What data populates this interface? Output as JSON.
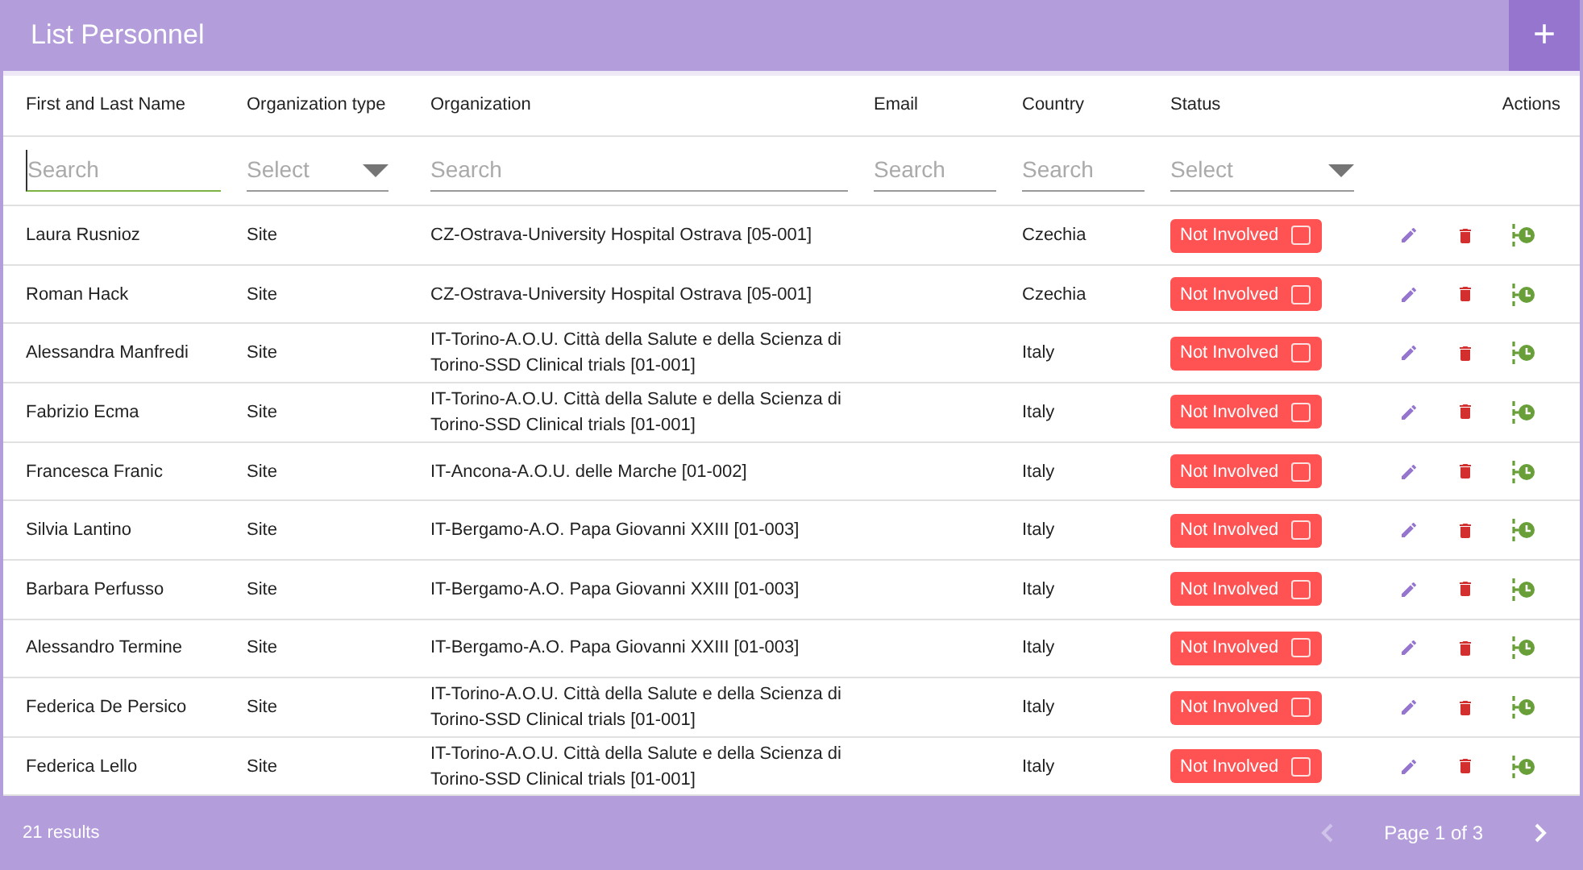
{
  "header": {
    "title": "List Personnel",
    "add_button": "+"
  },
  "columns": [
    "First and Last Name",
    "Organization type",
    "Organization",
    "Email",
    "Country",
    "Status",
    "Actions"
  ],
  "filters": [
    {
      "kind": "text",
      "placeholder": "Search",
      "focused": true
    },
    {
      "kind": "select",
      "placeholder": "Select",
      "focused": false
    },
    {
      "kind": "text",
      "placeholder": "Search",
      "focused": false
    },
    {
      "kind": "text",
      "placeholder": "Search",
      "focused": false
    },
    {
      "kind": "text",
      "placeholder": "Search",
      "focused": false
    },
    {
      "kind": "select",
      "placeholder": "Select",
      "focused": false
    }
  ],
  "rows": [
    {
      "name": "Laura Rusnioz",
      "type": "Site",
      "organization": "CZ-Ostrava-University Hospital Ostrava [05-001]",
      "email": "",
      "country": "Czechia",
      "status": "Not Involved",
      "checked": false
    },
    {
      "name": "Roman Hack",
      "type": "Site",
      "organization": "CZ-Ostrava-University Hospital Ostrava [05-001]",
      "email": "",
      "country": "Czechia",
      "status": "Not Involved",
      "checked": false
    },
    {
      "name": "Alessandra Manfredi",
      "type": "Site",
      "organization": "IT-Torino-A.O.U. Città della Salute e della Scienza di Torino-SSD Clinical trials [01-001]",
      "email": "",
      "country": "Italy",
      "status": "Not Involved",
      "checked": false
    },
    {
      "name": "Fabrizio Ecma",
      "type": "Site",
      "organization": "IT-Torino-A.O.U. Città della Salute e della Scienza di Torino-SSD Clinical trials [01-001]",
      "email": "",
      "country": "Italy",
      "status": "Not Involved",
      "checked": false
    },
    {
      "name": "Francesca Franic",
      "type": "Site",
      "organization": "IT-Ancona-A.O.U. delle Marche [01-002]",
      "email": "",
      "country": "Italy",
      "status": "Not Involved",
      "checked": false
    },
    {
      "name": "Silvia Lantino",
      "type": "Site",
      "organization": "IT-Bergamo-A.O. Papa Giovanni XXIII [01-003]",
      "email": "",
      "country": "Italy",
      "status": "Not Involved",
      "checked": false
    },
    {
      "name": "Barbara Perfusso",
      "type": "Site",
      "organization": "IT-Bergamo-A.O. Papa Giovanni XXIII [01-003]",
      "email": "",
      "country": "Italy",
      "status": "Not Involved",
      "checked": false
    },
    {
      "name": "Alessandro Termine",
      "type": "Site",
      "organization": "IT-Bergamo-A.O. Papa Giovanni XXIII [01-003]",
      "email": "",
      "country": "Italy",
      "status": "Not Involved",
      "checked": false
    },
    {
      "name": "Federica De Persico",
      "type": "Site",
      "organization": "IT-Torino-A.O.U. Città della Salute e della Scienza di Torino-SSD Clinical trials [01-001]",
      "email": "",
      "country": "Italy",
      "status": "Not Involved",
      "checked": false
    },
    {
      "name": "Federica Lello",
      "type": "Site",
      "organization": "IT-Torino-A.O.U. Città della Salute e della Scienza di Torino-SSD Clinical trials [01-001]",
      "email": "",
      "country": "Italy",
      "status": "Not Involved",
      "checked": false
    }
  ],
  "footer": {
    "results": "21 results",
    "page": "Page 1 of 3",
    "prev_disabled": true,
    "next_disabled": false
  }
}
